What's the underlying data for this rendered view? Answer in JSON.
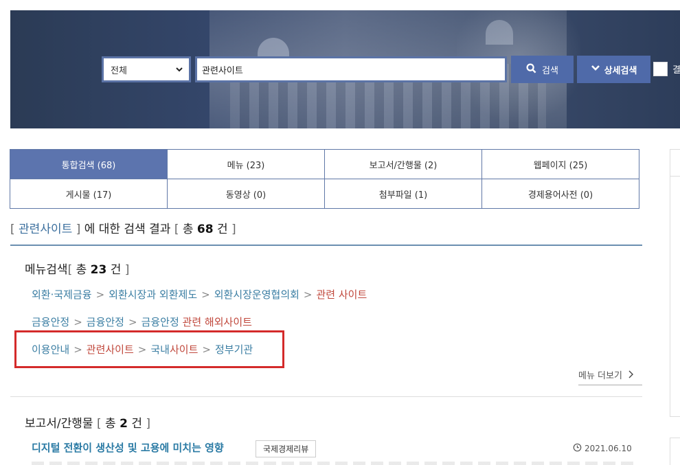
{
  "search": {
    "scope_value": "전체",
    "query_value": "관련사이트",
    "search_button": "검색",
    "advanced_button": "상세검색",
    "checkbox_label": "결"
  },
  "tabs": [
    {
      "label": "통합검색 (68)",
      "active": true
    },
    {
      "label": "메뉴 (23)",
      "active": false
    },
    {
      "label": "보고서/간행물 (2)",
      "active": false
    },
    {
      "label": "웹페이지 (25)",
      "active": false
    },
    {
      "label": "게시물 (17)",
      "active": false
    },
    {
      "label": "동영상 (0)",
      "active": false
    },
    {
      "label": "첨부파일 (1)",
      "active": false
    },
    {
      "label": "경제용어사전 (0)",
      "active": false
    }
  ],
  "summary": {
    "open": "[",
    "keyword": "관련사이트",
    "close": "]",
    "mid": "에 대한 검색 결과",
    "open2": "[",
    "total_prefix": "총",
    "total": "68",
    "unit": "건",
    "close2": "]"
  },
  "menu_section": {
    "title": "메뉴검색",
    "open": "[",
    "total_prefix": "총",
    "total": "23",
    "unit": "건",
    "close": "]",
    "separator": ">",
    "results": [
      {
        "parts": [
          "외환·국제금융",
          "외환시장과 외환제도",
          "외환시장운영협의회"
        ],
        "hit": "관련 사이트"
      },
      {
        "parts": [
          "금융안정",
          "금융안정",
          "금융안정 "
        ],
        "hit_a": "관련",
        "mid": " 해외",
        "hit_b": "사이트"
      },
      {
        "p1": "이용안내",
        "hit": "관련사이트",
        "p2a": "국내",
        "p2b": "사이트",
        "p3": "정부기관"
      }
    ],
    "more": "메뉴 더보기"
  },
  "report_section": {
    "title": "보고서/간행물",
    "open": "[",
    "total_prefix": "총",
    "total": "2",
    "unit": "건",
    "close": "]",
    "item_title": "디지털 전환이 생산성 및 고용에 미치는 영향",
    "item_tag": "국제경제리뷰",
    "item_date": "2021.06.10"
  },
  "colors": {
    "accent": "#5c74ae",
    "link": "#3b7ea3",
    "hit": "#c0473b",
    "highlight_box": "#d42a2a"
  }
}
